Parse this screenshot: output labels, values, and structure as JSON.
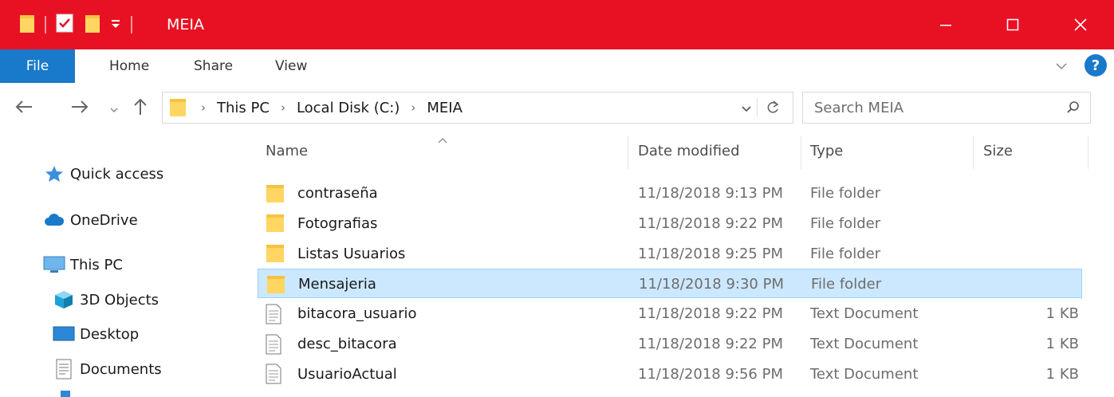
{
  "window": {
    "title": "MEIA",
    "controls": {
      "minimize": "minimize-icon",
      "maximize": "maximize-icon",
      "close": "close-icon"
    }
  },
  "quick_access_toolbar": {
    "icons": [
      "folder-icon",
      "properties-icon",
      "new-folder-icon",
      "customize-dropdown-icon"
    ]
  },
  "ribbon": {
    "tabs": [
      {
        "label": "File",
        "active": true
      },
      {
        "label": "Home"
      },
      {
        "label": "Share"
      },
      {
        "label": "View"
      }
    ],
    "help_label": "?"
  },
  "navigation": {
    "breadcrumbs": [
      "This PC",
      "Local Disk (C:)",
      "MEIA"
    ],
    "search_placeholder": "Search MEIA"
  },
  "sidebar": {
    "items": [
      {
        "label": "Quick access",
        "icon": "star-icon"
      },
      {
        "label": "OneDrive",
        "icon": "cloud-icon"
      },
      {
        "label": "This PC",
        "icon": "computer-icon"
      },
      {
        "label": "3D Objects",
        "icon": "cube-icon"
      },
      {
        "label": "Desktop",
        "icon": "desktop-icon"
      },
      {
        "label": "Documents",
        "icon": "documents-icon"
      }
    ]
  },
  "file_list": {
    "columns": [
      "Name",
      "Date modified",
      "Type",
      "Size"
    ],
    "rows": [
      {
        "name": "contraseña",
        "date": "11/18/2018 9:13 PM",
        "type": "File folder",
        "size": "",
        "icon": "folder-icon"
      },
      {
        "name": "Fotografias",
        "date": "11/18/2018 9:22 PM",
        "type": "File folder",
        "size": "",
        "icon": "folder-icon"
      },
      {
        "name": "Listas Usuarios",
        "date": "11/18/2018 9:25 PM",
        "type": "File folder",
        "size": "",
        "icon": "folder-icon"
      },
      {
        "name": "Mensajeria",
        "date": "11/18/2018 9:30 PM",
        "type": "File folder",
        "size": "",
        "icon": "folder-icon",
        "selected": true
      },
      {
        "name": "bitacora_usuario",
        "date": "11/18/2018 9:22 PM",
        "type": "Text Document",
        "size": "1 KB",
        "icon": "text-file-icon"
      },
      {
        "name": "desc_bitacora",
        "date": "11/18/2018 9:22 PM",
        "type": "Text Document",
        "size": "1 KB",
        "icon": "text-file-icon"
      },
      {
        "name": "UsuarioActual",
        "date": "11/18/2018 9:56 PM",
        "type": "Text Document",
        "size": "1 KB",
        "icon": "text-file-icon"
      }
    ]
  },
  "colors": {
    "titlebar": "#e81123",
    "file_tab": "#1979ca",
    "selection": "#cce8ff",
    "selection_border": "#99d1ff",
    "folder": "#ffd662"
  }
}
